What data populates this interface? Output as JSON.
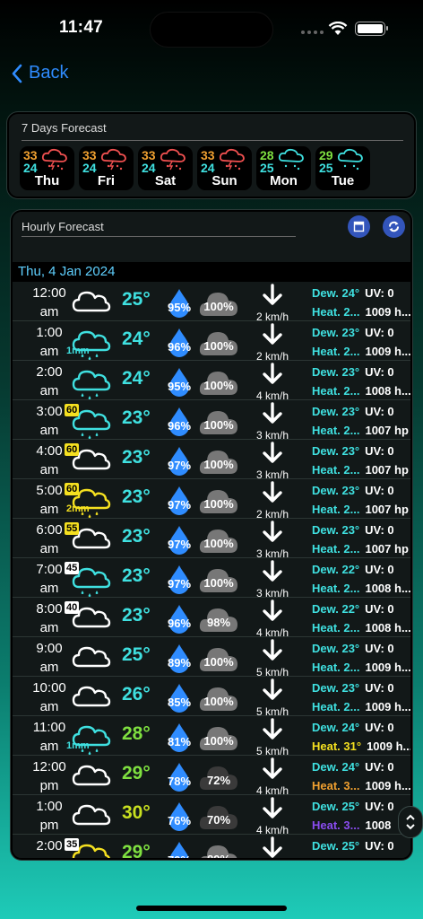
{
  "status": {
    "time": "11:47"
  },
  "nav": {
    "back_label": "Back"
  },
  "weekly": {
    "title": "7 Days Forecast",
    "days": [
      {
        "hi": "33",
        "lo": "24",
        "name": "Thu",
        "icon": "storm-rain-icon"
      },
      {
        "hi": "33",
        "lo": "24",
        "name": "Fri",
        "icon": "storm-rain-icon"
      },
      {
        "hi": "33",
        "lo": "24",
        "name": "Sat",
        "icon": "storm-rain-icon"
      },
      {
        "hi": "33",
        "lo": "24",
        "name": "Sun",
        "icon": "storm-rain-icon"
      },
      {
        "hi": "28",
        "lo": "25",
        "name": "Mon",
        "icon": "rain-icon"
      },
      {
        "hi": "29",
        "lo": "25",
        "name": "Tue",
        "icon": "rain-icon"
      }
    ]
  },
  "hourly": {
    "title": "Hourly Forecast",
    "date": "Thu, 4 Jan 2024",
    "rows": [
      {
        "h": "12:00",
        "ap": "am",
        "temp": "25°",
        "hum": "95%",
        "cloud": "100%",
        "wind": "2 km/h",
        "dew": "Dew. 24°",
        "uv": "UV: 0",
        "heat": "Heat. 2...",
        "press": "1009 h...",
        "wx": "cloud",
        "badge": "",
        "mm": ""
      },
      {
        "h": "1:00",
        "ap": "am",
        "temp": "24°",
        "hum": "96%",
        "cloud": "100%",
        "wind": "2 km/h",
        "dew": "Dew. 23°",
        "uv": "UV: 0",
        "heat": "Heat. 2...",
        "press": "1009 h...",
        "wx": "rain",
        "badge": "",
        "mm": "1mm"
      },
      {
        "h": "2:00",
        "ap": "am",
        "temp": "24°",
        "hum": "95%",
        "cloud": "100%",
        "wind": "4 km/h",
        "dew": "Dew. 23°",
        "uv": "UV: 0",
        "heat": "Heat. 2...",
        "press": "1008 h...",
        "wx": "rain",
        "badge": "",
        "mm": ""
      },
      {
        "h": "3:00",
        "ap": "am",
        "temp": "23°",
        "hum": "96%",
        "cloud": "100%",
        "wind": "3 km/h",
        "dew": "Dew. 23°",
        "uv": "UV: 0",
        "heat": "Heat. 2...",
        "press": "1007 hp",
        "wx": "rain",
        "badge": "60",
        "mm": ""
      },
      {
        "h": "4:00",
        "ap": "am",
        "temp": "23°",
        "hum": "97%",
        "cloud": "100%",
        "wind": "3 km/h",
        "dew": "Dew. 23°",
        "uv": "UV: 0",
        "heat": "Heat. 2...",
        "press": "1007 hp",
        "wx": "cloud",
        "badge": "60",
        "mm": ""
      },
      {
        "h": "5:00",
        "ap": "am",
        "temp": "23°",
        "hum": "97%",
        "cloud": "100%",
        "wind": "2 km/h",
        "dew": "Dew. 23°",
        "uv": "UV: 0",
        "heat": "Heat. 2...",
        "press": "1007 hp",
        "wx": "rainY",
        "badge": "60",
        "mm": "2mm"
      },
      {
        "h": "6:00",
        "ap": "am",
        "temp": "23°",
        "hum": "97%",
        "cloud": "100%",
        "wind": "3 km/h",
        "dew": "Dew. 23°",
        "uv": "UV: 0",
        "heat": "Heat. 2...",
        "press": "1007 hp",
        "wx": "cloud",
        "badge": "55",
        "mm": ""
      },
      {
        "h": "7:00",
        "ap": "am",
        "temp": "23°",
        "hum": "97%",
        "cloud": "100%",
        "wind": "3 km/h",
        "dew": "Dew. 22°",
        "uv": "UV: 0",
        "heat": "Heat. 2...",
        "press": "1008 h...",
        "wx": "rain",
        "badge": "45",
        "mm": ""
      },
      {
        "h": "8:00",
        "ap": "am",
        "temp": "23°",
        "hum": "96%",
        "cloud": "98%",
        "wind": "4 km/h",
        "dew": "Dew. 22°",
        "uv": "UV: 0",
        "heat": "Heat. 2...",
        "press": "1008 h...",
        "wx": "cloud",
        "badge": "40",
        "mm": ""
      },
      {
        "h": "9:00",
        "ap": "am",
        "temp": "25°",
        "hum": "89%",
        "cloud": "100%",
        "wind": "5 km/h",
        "dew": "Dew. 23°",
        "uv": "UV: 0",
        "heat": "Heat. 2...",
        "press": "1009 h...",
        "wx": "cloud",
        "badge": "",
        "mm": ""
      },
      {
        "h": "10:00",
        "ap": "am",
        "temp": "26°",
        "hum": "85%",
        "cloud": "100%",
        "wind": "5 km/h",
        "dew": "Dew. 23°",
        "uv": "UV: 0",
        "heat": "Heat. 2...",
        "press": "1009 h...",
        "wx": "cloud",
        "badge": "",
        "mm": ""
      },
      {
        "h": "11:00",
        "ap": "am",
        "temp": "28°",
        "hum": "81%",
        "cloud": "100%",
        "wind": "5 km/h",
        "dew": "Dew. 24°",
        "uv": "UV: 0",
        "heat": "Heat. 31°",
        "press": "1009 h...",
        "wx": "rain",
        "badge": "",
        "mm": "1mm"
      },
      {
        "h": "12:00",
        "ap": "pm",
        "temp": "29°",
        "hum": "78%",
        "cloud": "72%",
        "wind": "4 km/h",
        "dew": "Dew. 24°",
        "uv": "UV: 0",
        "heat": "Heat. 3...",
        "press": "1009 h...",
        "wx": "cloud",
        "badge": "",
        "mm": ""
      },
      {
        "h": "1:00",
        "ap": "pm",
        "temp": "30°",
        "hum": "76%",
        "cloud": "70%",
        "wind": "4 km/h",
        "dew": "Dew. 25°",
        "uv": "UV: 0",
        "heat": "Heat. 3...",
        "press": "1008",
        "wx": "cloud",
        "badge": "",
        "mm": ""
      },
      {
        "h": "2:00",
        "ap": "pm",
        "temp": "29°",
        "hum": "79%",
        "cloud": "89%",
        "wind": "",
        "dew": "Dew. 25°",
        "uv": "UV: 0",
        "heat": "",
        "press": "",
        "wx": "cloudY",
        "badge": "35",
        "mm": ""
      }
    ]
  },
  "colors": {
    "temp_cool": "#3fe0e0",
    "temp_warm": "#7fe040",
    "temp_hot": "#c8e020",
    "heat_warm": "#f0a030",
    "heat_hot": "#8a4cf0",
    "badge_yellow": "#f5e020",
    "badge_white": "#ffffff"
  }
}
